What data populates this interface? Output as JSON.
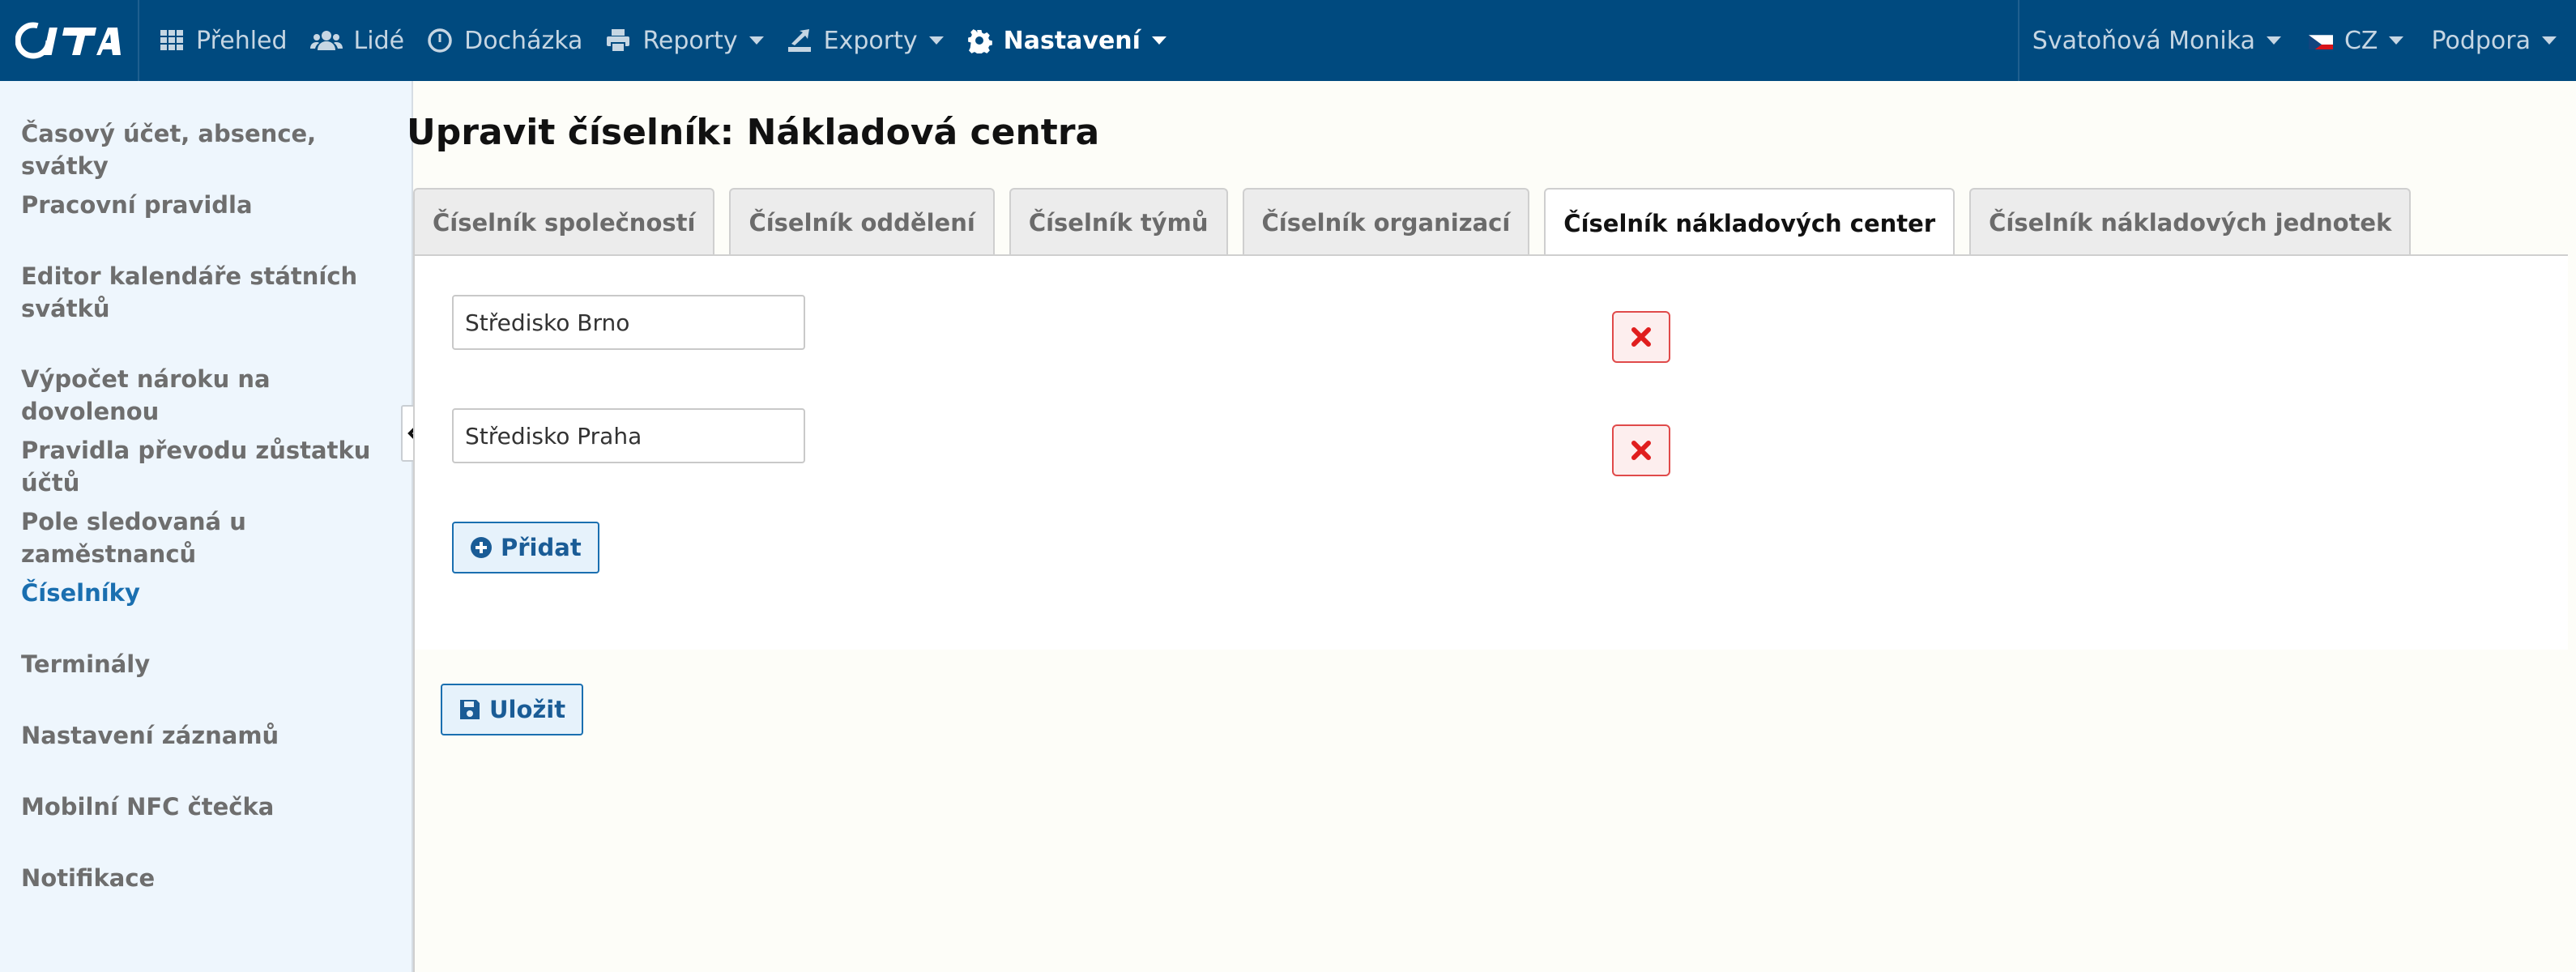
{
  "brand": {
    "logo_text": "CITA"
  },
  "topnav": {
    "items": [
      {
        "label": "Přehled",
        "icon": "grid-icon"
      },
      {
        "label": "Lidé",
        "icon": "users-icon"
      },
      {
        "label": "Docházka",
        "icon": "clock-icon"
      },
      {
        "label": "Reporty",
        "icon": "printer-icon"
      },
      {
        "label": "Exporty",
        "icon": "export-icon"
      },
      {
        "label": "Nastavení",
        "icon": "gear-icon"
      }
    ],
    "user": "Svatoňová Monika",
    "language": "CZ",
    "support": "Podpora"
  },
  "sidebar": {
    "items": [
      {
        "label": "Časový účet, absence, svátky"
      },
      {
        "label": "Pracovní pravidla"
      },
      {
        "label": "Editor kalendáře státních svátků"
      },
      {
        "label": "Výpočet nároku na dovolenou"
      },
      {
        "label": "Pravidla převodu zůstatku účtů"
      },
      {
        "label": "Pole sledovaná u zaměstnanců"
      },
      {
        "label": "Číselníky"
      },
      {
        "label": "Terminály"
      },
      {
        "label": "Nastavení záznamů"
      },
      {
        "label": "Mobilní NFC čtečka"
      },
      {
        "label": "Notifikace"
      }
    ],
    "active_index": 6
  },
  "main": {
    "title": "Upravit číselník: Nákladová centra",
    "tabs": [
      {
        "label": "Číselník společností"
      },
      {
        "label": "Číselník oddělení"
      },
      {
        "label": "Číselník týmů"
      },
      {
        "label": "Číselník organizací"
      },
      {
        "label": "Číselník nákladových center"
      },
      {
        "label": "Číselník nákladových jednotek"
      }
    ],
    "active_tab_index": 4,
    "entries": [
      {
        "value": "Středisko Brno"
      },
      {
        "value": "Středisko Praha"
      }
    ],
    "add_label": "Přidat",
    "save_label": "Uložit"
  },
  "colors": {
    "topbar": "#004a7f",
    "sidebar_bg": "#eef6fd",
    "accent": "#1a6fb0",
    "danger": "#e04a4a"
  }
}
